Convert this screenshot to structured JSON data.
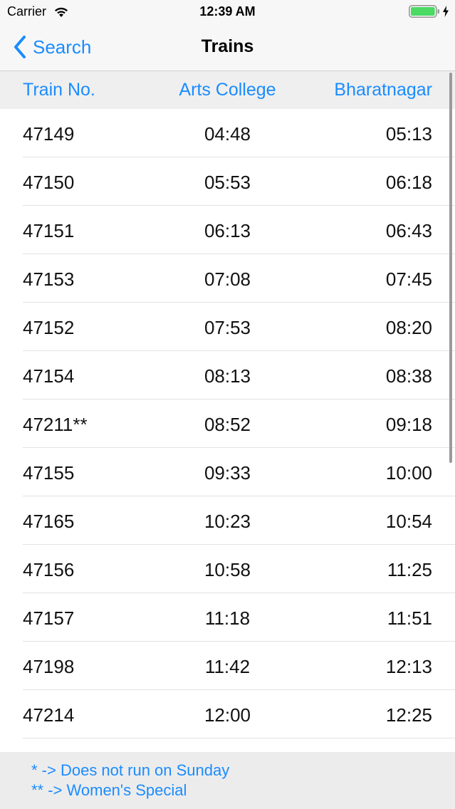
{
  "status_bar": {
    "carrier": "Carrier",
    "time": "12:39 AM",
    "battery_color": "#4cd964"
  },
  "nav": {
    "back_label": "Search",
    "title": "Trains",
    "accent_color": "#1a8cff"
  },
  "table": {
    "headers": [
      "Train No.",
      "Arts College",
      "Bharatnagar"
    ],
    "rows": [
      [
        "47149",
        "04:48",
        "05:13"
      ],
      [
        "47150",
        "05:53",
        "06:18"
      ],
      [
        "47151",
        "06:13",
        "06:43"
      ],
      [
        "47153",
        "07:08",
        "07:45"
      ],
      [
        "47152",
        "07:53",
        "08:20"
      ],
      [
        "47154",
        "08:13",
        "08:38"
      ],
      [
        "47211**",
        "08:52",
        "09:18"
      ],
      [
        "47155",
        "09:33",
        "10:00"
      ],
      [
        "47165",
        "10:23",
        "10:54"
      ],
      [
        "47156",
        "10:58",
        "11:25"
      ],
      [
        "47157",
        "11:18",
        "11:51"
      ],
      [
        "47198",
        "11:42",
        "12:13"
      ],
      [
        "47214",
        "12:00",
        "12:25"
      ]
    ]
  },
  "legend": {
    "line1": "* -> Does not run on Sunday",
    "line2": "** -> Women's Special"
  }
}
